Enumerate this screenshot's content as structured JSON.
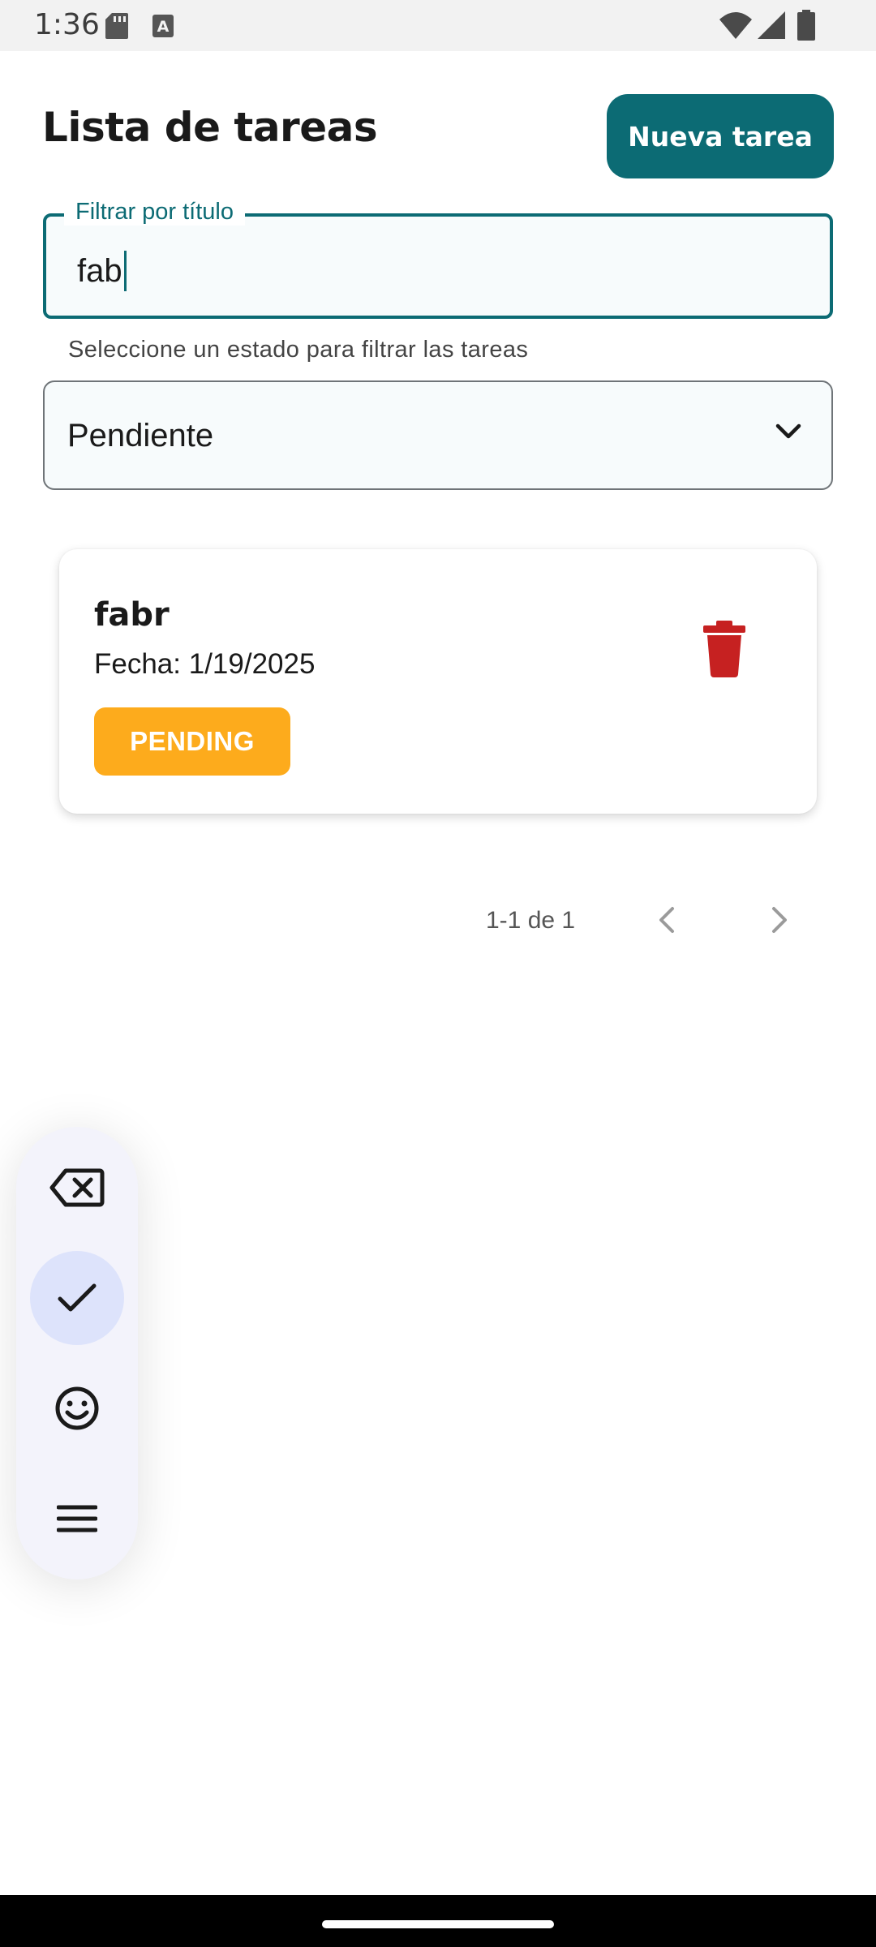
{
  "status_bar": {
    "time": "1:36",
    "icons": [
      "sd-card-icon",
      "keyboard-a-icon",
      "wifi-icon",
      "signal-icon",
      "battery-icon"
    ]
  },
  "header": {
    "title": "Lista de tareas",
    "new_task_label": "Nueva tarea"
  },
  "filter": {
    "label": "Filtrar por título",
    "value": "fab"
  },
  "status_filter": {
    "helper": "Seleccione un estado para filtrar las tareas",
    "selected": "Pendiente"
  },
  "tasks": [
    {
      "title": "fabr",
      "date": "Fecha: 1/19/2025",
      "status": "PENDING"
    }
  ],
  "pagination": {
    "range": "1-1 de 1"
  },
  "keyboard_toolbar": {
    "buttons": [
      "backspace-icon",
      "check-icon",
      "emoji-icon",
      "menu-icon"
    ],
    "active": "check-icon"
  },
  "colors": {
    "primary": "#0c6b74",
    "badge_pending": "#fdab1c",
    "delete": "#c62121"
  }
}
